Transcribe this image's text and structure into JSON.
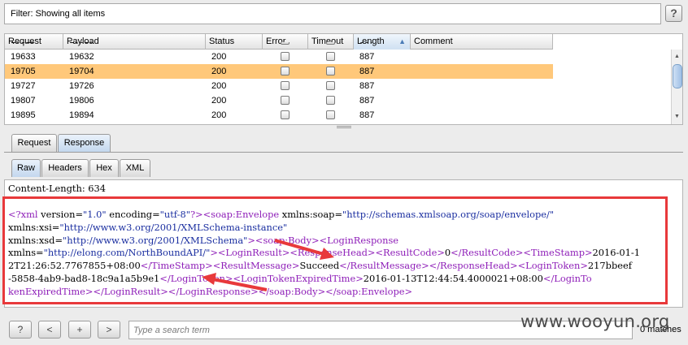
{
  "filter": {
    "text": "Filter: Showing all items",
    "help_label": "?"
  },
  "table": {
    "columns": [
      "Request",
      "Payload",
      "Status",
      "Error",
      "Timeout",
      "Length",
      "Comment"
    ],
    "sorted_column": "Length",
    "partial_top_row": {
      "request": "19611",
      "payload": "19610",
      "length": "887"
    },
    "rows": [
      {
        "request": "19633",
        "payload": "19632",
        "status": "200",
        "length": "887",
        "selected": false
      },
      {
        "request": "19705",
        "payload": "19704",
        "status": "200",
        "length": "887",
        "selected": true
      },
      {
        "request": "19727",
        "payload": "19726",
        "status": "200",
        "length": "887",
        "selected": false
      },
      {
        "request": "19807",
        "payload": "19806",
        "status": "200",
        "length": "887",
        "selected": false
      },
      {
        "request": "19895",
        "payload": "19894",
        "status": "200",
        "length": "887",
        "selected": false
      }
    ]
  },
  "tabs": {
    "main": [
      "Request",
      "Response"
    ],
    "main_selected": "Response",
    "view": [
      "Raw",
      "Headers",
      "Hex",
      "XML"
    ],
    "view_selected": "Raw"
  },
  "response": {
    "content_length_line": "Content-Length: 634",
    "xml_lines": [
      [
        {
          "t": "tg",
          "v": "<?xml "
        },
        {
          "t": "at",
          "v": "version="
        },
        {
          "t": "vl",
          "v": "\"1.0\""
        },
        {
          "t": "at",
          "v": " encoding="
        },
        {
          "t": "vl",
          "v": "\"utf-8\""
        },
        {
          "t": "tg",
          "v": "?>"
        },
        {
          "t": "tg",
          "v": "<soap:Envelope "
        },
        {
          "t": "at",
          "v": "xmlns:soap="
        },
        {
          "t": "vl",
          "v": "\"http://schemas.xmlsoap.org/soap/envelope/\""
        }
      ],
      [
        {
          "t": "at",
          "v": "xmlns:xsi="
        },
        {
          "t": "vl",
          "v": "\"http://www.w3.org/2001/XMLSchema-instance\""
        }
      ],
      [
        {
          "t": "at",
          "v": "xmlns:xsd="
        },
        {
          "t": "vl",
          "v": "\"http://www.w3.org/2001/XMLSchema\""
        },
        {
          "t": "tg",
          "v": "><soap:Body><LoginResponse"
        }
      ],
      [
        {
          "t": "at",
          "v": "xmlns="
        },
        {
          "t": "vl",
          "v": "\"http://elong.com/NorthBoundAPI/\""
        },
        {
          "t": "tg",
          "v": "><LoginResult><ResponseHead><ResultCode>"
        },
        {
          "t": "tx",
          "v": "0"
        },
        {
          "t": "tg",
          "v": "</ResultCode><TimeStamp>"
        },
        {
          "t": "tx",
          "v": "2016-01-1"
        }
      ],
      [
        {
          "t": "tx",
          "v": "2T21:26:52.7767855+08:00"
        },
        {
          "t": "tg",
          "v": "</TimeStamp><ResultMessage>"
        },
        {
          "t": "tx",
          "v": "Succeed"
        },
        {
          "t": "tg",
          "v": "</ResultMessage></ResponseHead><LoginToken>"
        },
        {
          "t": "tx",
          "v": "217bbeef"
        }
      ],
      [
        {
          "t": "tx",
          "v": "-5858-4ab9-bad8-18c9a1a5b9e1"
        },
        {
          "t": "tg",
          "v": "</LoginToken><LoginTokenExpiredTime>"
        },
        {
          "t": "tx",
          "v": "2016-01-13T12:44:54.4000021+08:00"
        },
        {
          "t": "tg",
          "v": "</LoginTo"
        }
      ],
      [
        {
          "t": "tg",
          "v": "kenExpiredTime></LoginResult></LoginResponse></soap:Body></soap:Envelope>"
        }
      ]
    ]
  },
  "bottom": {
    "help_label": "?",
    "prev_label": "<",
    "add_label": "+",
    "next_label": ">",
    "search_placeholder": "Type a search term",
    "matches": "0 matches"
  },
  "watermark": "www.wooyun.org",
  "colors": {
    "selected_row": "#ffc87a",
    "highlight_box": "#e8393b",
    "arrow": "#e8393b"
  }
}
